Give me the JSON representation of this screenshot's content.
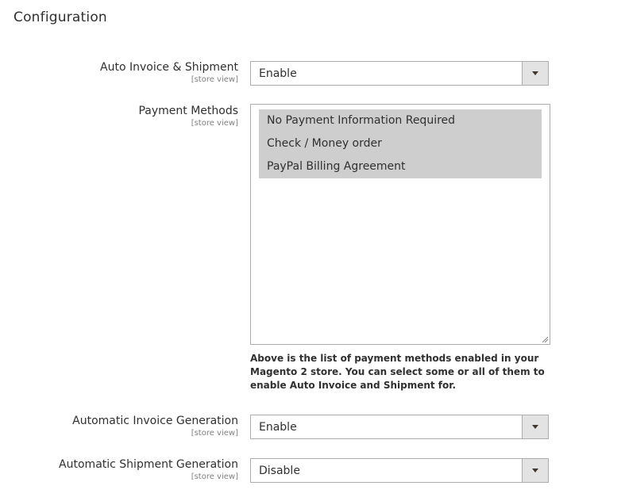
{
  "section": {
    "title": "Configuration"
  },
  "fields": {
    "auto_invoice_shipment": {
      "label": "Auto Invoice & Shipment",
      "scope": "[store view]",
      "value": "Enable"
    },
    "payment_methods": {
      "label": "Payment Methods",
      "scope": "[store view]",
      "options": [
        "No Payment Information Required",
        "Check / Money order",
        "PayPal Billing Agreement"
      ],
      "note": "Above is the list of payment methods enabled in your Magento 2 store. You can select some or all of them to enable Auto Invoice and Shipment for."
    },
    "automatic_invoice_generation": {
      "label": "Automatic Invoice Generation",
      "scope": "[store view]",
      "value": "Enable"
    },
    "automatic_shipment_generation": {
      "label": "Automatic Shipment Generation",
      "scope": "[store view]",
      "value": "Disable"
    }
  },
  "icons": {
    "dropdown": "chevron-down-icon",
    "resize": "resize-handle-icon"
  },
  "colors": {
    "selected_option_bg": "#cecece",
    "dropdown_button_bg": "#e3e3e3",
    "border": "#adadad"
  }
}
